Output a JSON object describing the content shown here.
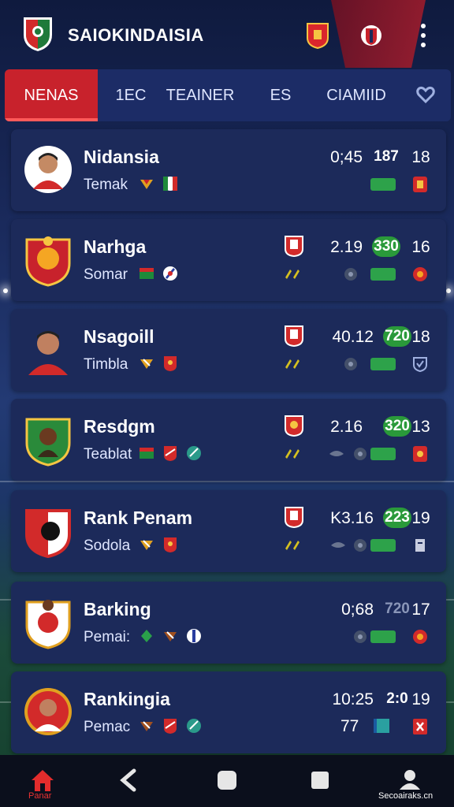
{
  "app": {
    "title": "SAIOKINDAISIA"
  },
  "tabs": [
    {
      "label": "NENAS",
      "active": true
    },
    {
      "label": "1EC"
    },
    {
      "label": "TEAINER"
    },
    {
      "label": "ES"
    },
    {
      "label": "CIAMIID"
    }
  ],
  "cards": [
    {
      "name": "Nidansia",
      "sub": "Temak",
      "stat_a": "0;45",
      "stat_b": "187",
      "stat_b_style": "plain",
      "stat_c": "18"
    },
    {
      "name": "Narhga",
      "sub": "Somar",
      "stat_a": "2.19",
      "stat_b": "330",
      "stat_b_style": "green",
      "stat_c": "16"
    },
    {
      "name": "Nsagoill",
      "sub": "Timbla",
      "stat_a": "40.12",
      "stat_b": "720",
      "stat_b_style": "green",
      "stat_c": "18"
    },
    {
      "name": "Resdgm",
      "sub": "Teablat",
      "stat_a": "2.16",
      "stat_b": "320",
      "stat_b_style": "green",
      "stat_c": "13"
    },
    {
      "name": "Rank Penam",
      "sub": "Sodola",
      "stat_a": "K3.16",
      "stat_b": "223",
      "stat_b_style": "green",
      "stat_c": "19"
    },
    {
      "name": "Barking",
      "sub": "Pemai:",
      "stat_a": "0;68",
      "stat_b": "720",
      "stat_b_style": "plain",
      "stat_c": "17"
    },
    {
      "name": "Rankingia",
      "sub": "Pemac",
      "stat_a": "10:25",
      "stat_b": "2:0",
      "stat_b_style": "plain",
      "stat_c": "19",
      "extra": "77"
    }
  ],
  "bottom_nav": {
    "home_label": "Panar",
    "user_label": "Secoairaks.cn"
  },
  "colors": {
    "accent": "#c8222c",
    "card": "#1c2a5a",
    "green": "#2a9a3a",
    "bg": "#1a2a5c"
  }
}
